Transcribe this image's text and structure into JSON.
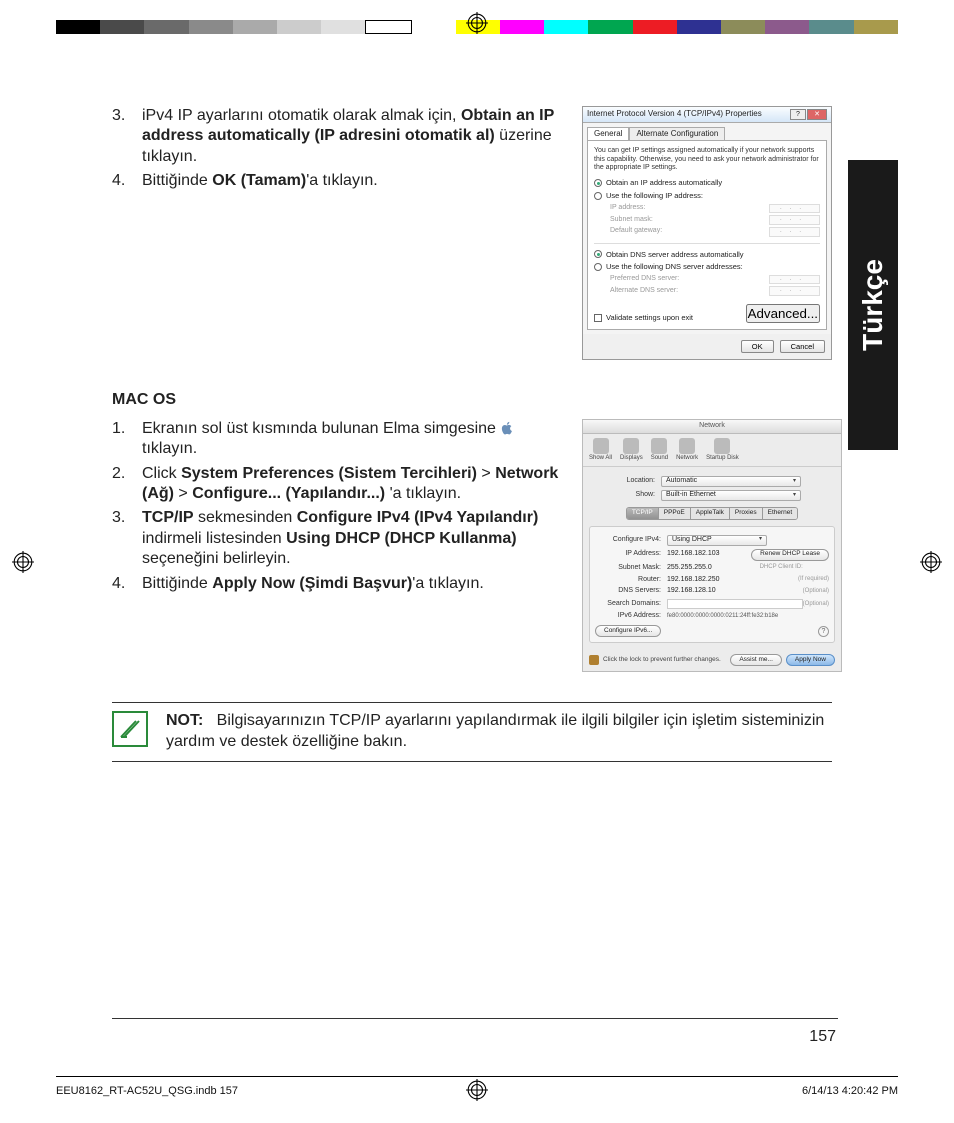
{
  "language_tab": "Türkçe",
  "section1": {
    "steps": [
      {
        "num": "3.",
        "pre": "iPv4 IP ayarlarını otomatik olarak almak için, ",
        "bold": "Obtain an IP address automatically (IP adresini otomatik al)",
        "post": " üzerine tıklayın."
      },
      {
        "num": "4.",
        "pre": "Bittiğinde ",
        "bold": "OK (Tamam)",
        "post": "'a tıklayın."
      }
    ]
  },
  "section2": {
    "heading": "MAC OS",
    "steps": [
      {
        "num": "1.",
        "pre": "Ekranın sol üst kısmında bulunan Elma simgesine ",
        "icon": "apple",
        "post": " tıklayın."
      },
      {
        "num": "2.",
        "pre": "Click ",
        "bold1": "System Preferences (Sistem Tercihleri)",
        "mid1": " > ",
        "bold2": "Network (Ağ)",
        "mid2": " > ",
        "bold3": "Configure... (Yapılandır...)",
        "post": " 'a tıklayın."
      },
      {
        "num": "3.",
        "bold1": "TCP/IP",
        "mid1": " sekmesinden ",
        "bold2": "Configure IPv4 (IPv4 Yapılandır)",
        "mid2": " indirmeli listesinden ",
        "bold3": "Using DHCP (DHCP Kullanma)",
        "post": " seçeneğini belirleyin."
      },
      {
        "num": "4.",
        "pre": "Bittiğinde ",
        "bold1": "Apply Now (Şimdi Başvur)",
        "post": "'a tıklayın."
      }
    ]
  },
  "note": {
    "label": "NOT:",
    "text": "Bilgisayarınızın TCP/IP ayarlarını yapılandırmak ile ilgili bilgiler için işletim sisteminizin yardım ve destek özelliğine bakın."
  },
  "win_dialog": {
    "title": "Internet Protocol Version 4 (TCP/IPv4) Properties",
    "tabs": [
      "General",
      "Alternate Configuration"
    ],
    "desc": "You can get IP settings assigned automatically if your network supports this capability. Otherwise, you need to ask your network administrator for the appropriate IP settings.",
    "radio_obtain_ip": "Obtain an IP address automatically",
    "radio_use_ip": "Use the following IP address:",
    "ip_address": "IP address:",
    "subnet": "Subnet mask:",
    "gateway": "Default gateway:",
    "radio_obtain_dns": "Obtain DNS server address automatically",
    "radio_use_dns": "Use the following DNS server addresses:",
    "pref_dns": "Preferred DNS server:",
    "alt_dns": "Alternate DNS server:",
    "validate": "Validate settings upon exit",
    "advanced": "Advanced...",
    "ok": "OK",
    "cancel": "Cancel"
  },
  "mac_dialog": {
    "title": "Network",
    "toolbar": [
      "Show All",
      "Displays",
      "Sound",
      "Network",
      "Startup Disk"
    ],
    "location_label": "Location:",
    "location_value": "Automatic",
    "show_label": "Show:",
    "show_value": "Built-in Ethernet",
    "tabs": [
      "TCP/IP",
      "PPPoE",
      "AppleTalk",
      "Proxies",
      "Ethernet"
    ],
    "configure_label": "Configure IPv4:",
    "configure_value": "Using DHCP",
    "ip_label": "IP Address:",
    "ip_value": "192.168.182.103",
    "renew": "Renew DHCP Lease",
    "subnet_label": "Subnet Mask:",
    "subnet_value": "255.255.255.0",
    "client_label": "DHCP Client ID:",
    "client_hint": "(If required)",
    "router_label": "Router:",
    "router_value": "192.168.182.250",
    "dns_label": "DNS Servers:",
    "dns_value": "192.168.128.10",
    "optional": "(Optional)",
    "search_label": "Search Domains:",
    "ipv6_label": "IPv6 Address:",
    "ipv6_value": "fe80:0000:0000:0000:0211:24ff:fe32:b18e",
    "configure_ipv6": "Configure IPv6...",
    "lock_text": "Click the lock to prevent further changes.",
    "assist": "Assist me...",
    "apply": "Apply Now"
  },
  "page_number": "157",
  "imprint": {
    "file": "EEU8162_RT-AC52U_QSG.indb   157",
    "datetime": "6/14/13   4:20:42 PM"
  }
}
